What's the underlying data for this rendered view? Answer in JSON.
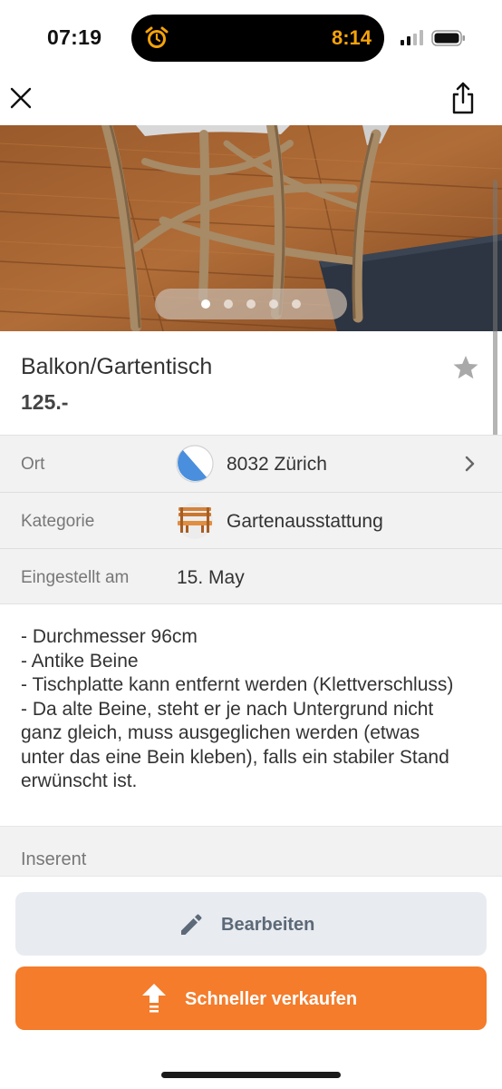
{
  "status_bar": {
    "time": "07:19",
    "island_time": "8:14",
    "island_icon": "alarm-clock-icon",
    "island_accent": "#f5a30a"
  },
  "nav": {
    "close_icon": "close-icon",
    "share_icon": "share-icon"
  },
  "photo": {
    "page_count": 5,
    "active_page": 1
  },
  "listing": {
    "title": "Balkon/Gartentisch",
    "price": "125.-",
    "favorite_icon": "star-icon"
  },
  "details": [
    {
      "label": "Ort",
      "value": "8032 Zürich",
      "icon": "zurich-coat-of-arms-icon"
    },
    {
      "label": "Kategorie",
      "value": "Gartenausstattung",
      "icon": "garden-bench-icon"
    },
    {
      "label": "Eingestellt am",
      "value": "15. May"
    }
  ],
  "description": [
    "- Durchmesser 96cm",
    "- Antike Beine",
    "- Tischplatte kann entfernt werden (Klettverschluss)",
    "- Da alte Beine, steht er je nach Untergrund nicht",
    "ganz gleich, muss ausgeglichen werden (etwas",
    "unter das eine Bein kleben), falls ein stabiler Stand",
    "erwünscht ist."
  ],
  "advertiser": {
    "label": "Inserent"
  },
  "actions": {
    "edit_label": "Bearbeiten",
    "sell_label": "Schneller verkaufen",
    "brand_color": "#f47c2b"
  }
}
